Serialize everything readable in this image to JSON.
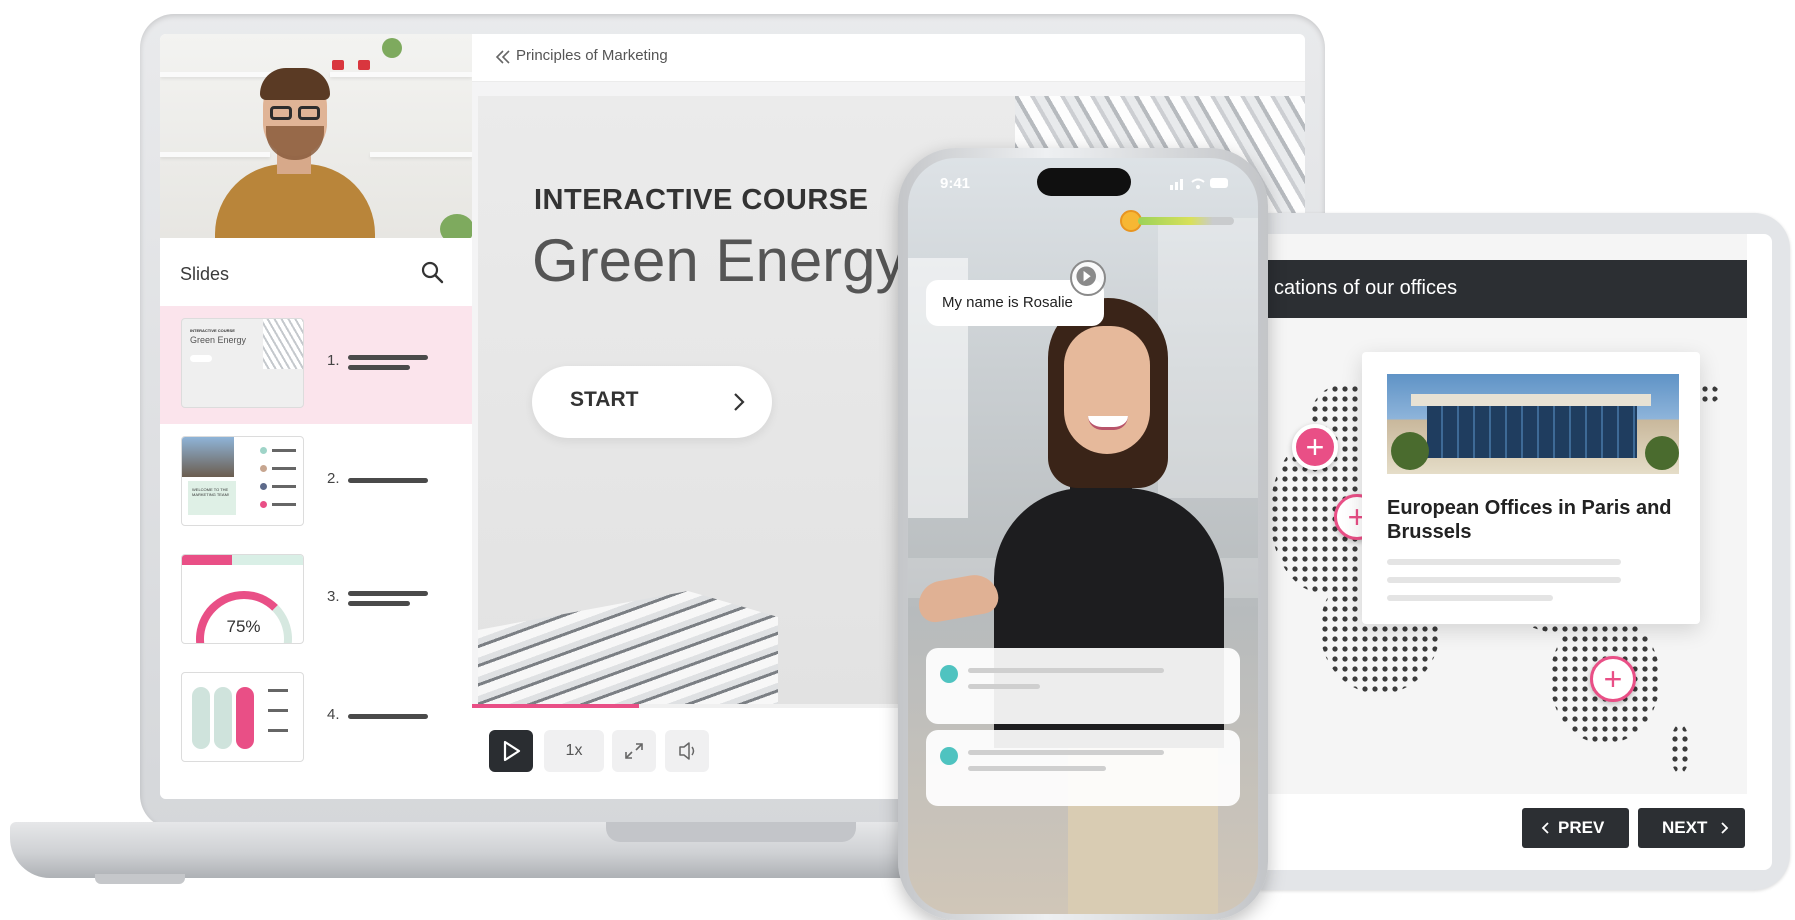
{
  "laptop": {
    "breadcrumb": "Principles of Marketing",
    "slides_panel": {
      "title": "Slides",
      "items": [
        {
          "number": "1.",
          "thumb_kicker": "INTERACTIVE COURSE",
          "thumb_title": "Green Energy",
          "active": true
        },
        {
          "number": "2.",
          "thumb_text": "WELCOME TO THE MARKETING TEAM!",
          "active": false
        },
        {
          "number": "3.",
          "thumb_text": "75%",
          "active": false
        },
        {
          "number": "4.",
          "active": false
        }
      ]
    },
    "slide": {
      "kicker": "INTERACTIVE COURSE",
      "title": "Green Energy",
      "start_label": "START"
    },
    "player": {
      "speed_label": "1x",
      "progress": 0.2
    }
  },
  "phone": {
    "time": "9:41",
    "speech_bubble": "My name is Rosalie"
  },
  "tablet": {
    "map_title": "cations of our offices",
    "card_title": "European Offices in Paris and Brussels",
    "prev_label": "PREV",
    "next_label": "NEXT"
  },
  "colors": {
    "accent": "#e94f86",
    "dark": "#2c2f33",
    "teal": "#4fc3c0"
  }
}
